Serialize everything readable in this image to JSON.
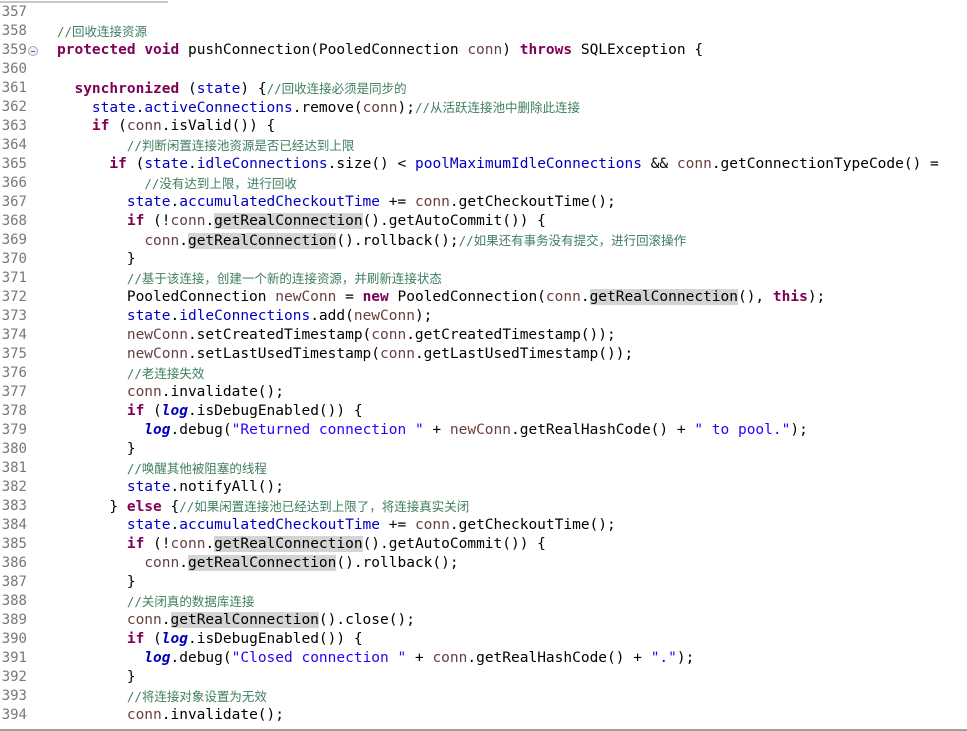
{
  "editor": {
    "colors": {
      "keyword": "#7f0055",
      "field": "#0000c0",
      "local": "#6a3e3e",
      "comment": "#3f7f5f",
      "string": "#2a00ff",
      "occurrence_highlight": "#d4d4d4"
    },
    "fold_icon_line": "359",
    "lines": [
      {
        "n": "357",
        "t": []
      },
      {
        "n": "358",
        "t": [
          [
            "c",
            "//回收连接资源"
          ]
        ]
      },
      {
        "n": "359",
        "t": [
          [
            "k",
            "protected"
          ],
          [
            "p",
            " "
          ],
          [
            "k",
            "void"
          ],
          [
            "p",
            " pushConnection(PooledConnection "
          ],
          [
            "v",
            "conn"
          ],
          [
            "p",
            ") "
          ],
          [
            "k",
            "throws"
          ],
          [
            "p",
            " SQLException {"
          ]
        ]
      },
      {
        "n": "360",
        "t": []
      },
      {
        "n": "361",
        "t": [
          [
            "p",
            "  "
          ],
          [
            "k",
            "synchronized"
          ],
          [
            "p",
            " ("
          ],
          [
            "f",
            "state"
          ],
          [
            "p",
            ") {"
          ],
          [
            "c",
            "//回收连接必须是同步的"
          ]
        ]
      },
      {
        "n": "362",
        "t": [
          [
            "p",
            "    "
          ],
          [
            "f",
            "state"
          ],
          [
            "p",
            "."
          ],
          [
            "f",
            "activeConnections"
          ],
          [
            "p",
            ".remove("
          ],
          [
            "v",
            "conn"
          ],
          [
            "p",
            ");"
          ],
          [
            "c",
            "//从活跃连接池中删除此连接"
          ]
        ]
      },
      {
        "n": "363",
        "t": [
          [
            "p",
            "    "
          ],
          [
            "k",
            "if"
          ],
          [
            "p",
            " ("
          ],
          [
            "v",
            "conn"
          ],
          [
            "p",
            ".isValid()) {"
          ]
        ]
      },
      {
        "n": "364",
        "t": [
          [
            "p",
            "        "
          ],
          [
            "c",
            "//判断闲置连接池资源是否已经达到上限"
          ]
        ]
      },
      {
        "n": "365",
        "t": [
          [
            "p",
            "      "
          ],
          [
            "k",
            "if"
          ],
          [
            "p",
            " ("
          ],
          [
            "f",
            "state"
          ],
          [
            "p",
            "."
          ],
          [
            "f",
            "idleConnections"
          ],
          [
            "p",
            ".size() < "
          ],
          [
            "f",
            "poolMaximumIdleConnections"
          ],
          [
            "p",
            " && "
          ],
          [
            "v",
            "conn"
          ],
          [
            "p",
            ".getConnectionTypeCode() ="
          ]
        ]
      },
      {
        "n": "366",
        "t": [
          [
            "p",
            "          "
          ],
          [
            "c",
            "//没有达到上限，进行回收"
          ]
        ]
      },
      {
        "n": "367",
        "t": [
          [
            "p",
            "        "
          ],
          [
            "f",
            "state"
          ],
          [
            "p",
            "."
          ],
          [
            "f",
            "accumulatedCheckoutTime"
          ],
          [
            "p",
            " += "
          ],
          [
            "v",
            "conn"
          ],
          [
            "p",
            ".getCheckoutTime();"
          ]
        ]
      },
      {
        "n": "368",
        "t": [
          [
            "p",
            "        "
          ],
          [
            "k",
            "if"
          ],
          [
            "p",
            " (!"
          ],
          [
            "v",
            "conn"
          ],
          [
            "p",
            "."
          ],
          [
            "h",
            "getRealConnection"
          ],
          [
            "p",
            "().getAutoCommit()) {"
          ]
        ]
      },
      {
        "n": "369",
        "t": [
          [
            "p",
            "          "
          ],
          [
            "v",
            "conn"
          ],
          [
            "p",
            "."
          ],
          [
            "h",
            "getRealConnection"
          ],
          [
            "p",
            "().rollback();"
          ],
          [
            "c",
            "//如果还有事务没有提交，进行回滚操作"
          ]
        ]
      },
      {
        "n": "370",
        "t": [
          [
            "p",
            "        }"
          ]
        ]
      },
      {
        "n": "371",
        "t": [
          [
            "p",
            "        "
          ],
          [
            "c",
            "//基于该连接，创建一个新的连接资源，并刷新连接状态"
          ]
        ]
      },
      {
        "n": "372",
        "t": [
          [
            "p",
            "        PooledConnection "
          ],
          [
            "v",
            "newConn"
          ],
          [
            "p",
            " = "
          ],
          [
            "k",
            "new"
          ],
          [
            "p",
            " PooledConnection("
          ],
          [
            "v",
            "conn"
          ],
          [
            "p",
            "."
          ],
          [
            "h",
            "getRealConnection"
          ],
          [
            "p",
            "(), "
          ],
          [
            "k",
            "this"
          ],
          [
            "p",
            ");"
          ]
        ]
      },
      {
        "n": "373",
        "t": [
          [
            "p",
            "        "
          ],
          [
            "f",
            "state"
          ],
          [
            "p",
            "."
          ],
          [
            "f",
            "idleConnections"
          ],
          [
            "p",
            ".add("
          ],
          [
            "v",
            "newConn"
          ],
          [
            "p",
            ");"
          ]
        ]
      },
      {
        "n": "374",
        "t": [
          [
            "p",
            "        "
          ],
          [
            "v",
            "newConn"
          ],
          [
            "p",
            ".setCreatedTimestamp("
          ],
          [
            "v",
            "conn"
          ],
          [
            "p",
            ".getCreatedTimestamp());"
          ]
        ]
      },
      {
        "n": "375",
        "t": [
          [
            "p",
            "        "
          ],
          [
            "v",
            "newConn"
          ],
          [
            "p",
            ".setLastUsedTimestamp("
          ],
          [
            "v",
            "conn"
          ],
          [
            "p",
            ".getLastUsedTimestamp());"
          ]
        ]
      },
      {
        "n": "376",
        "t": [
          [
            "p",
            "        "
          ],
          [
            "c",
            "//老连接失效"
          ]
        ]
      },
      {
        "n": "377",
        "t": [
          [
            "p",
            "        "
          ],
          [
            "v",
            "conn"
          ],
          [
            "p",
            ".invalidate();"
          ]
        ]
      },
      {
        "n": "378",
        "t": [
          [
            "p",
            "        "
          ],
          [
            "k",
            "if"
          ],
          [
            "p",
            " ("
          ],
          [
            "l",
            "log"
          ],
          [
            "p",
            ".isDebugEnabled()) {"
          ]
        ]
      },
      {
        "n": "379",
        "t": [
          [
            "p",
            "          "
          ],
          [
            "l",
            "log"
          ],
          [
            "p",
            ".debug("
          ],
          [
            "s",
            "\"Returned connection \""
          ],
          [
            "p",
            " + "
          ],
          [
            "v",
            "newConn"
          ],
          [
            "p",
            ".getRealHashCode() + "
          ],
          [
            "s",
            "\" to pool.\""
          ],
          [
            "p",
            ");"
          ]
        ]
      },
      {
        "n": "380",
        "t": [
          [
            "p",
            "        }"
          ]
        ]
      },
      {
        "n": "381",
        "t": [
          [
            "p",
            "        "
          ],
          [
            "c",
            "//唤醒其他被阻塞的线程"
          ]
        ]
      },
      {
        "n": "382",
        "t": [
          [
            "p",
            "        "
          ],
          [
            "f",
            "state"
          ],
          [
            "p",
            ".notifyAll();"
          ]
        ]
      },
      {
        "n": "383",
        "t": [
          [
            "p",
            "      } "
          ],
          [
            "k",
            "else"
          ],
          [
            "p",
            " {"
          ],
          [
            "c",
            "//如果闲置连接池已经达到上限了，将连接真实关闭"
          ]
        ]
      },
      {
        "n": "384",
        "t": [
          [
            "p",
            "        "
          ],
          [
            "f",
            "state"
          ],
          [
            "p",
            "."
          ],
          [
            "f",
            "accumulatedCheckoutTime"
          ],
          [
            "p",
            " += "
          ],
          [
            "v",
            "conn"
          ],
          [
            "p",
            ".getCheckoutTime();"
          ]
        ]
      },
      {
        "n": "385",
        "t": [
          [
            "p",
            "        "
          ],
          [
            "k",
            "if"
          ],
          [
            "p",
            " (!"
          ],
          [
            "v",
            "conn"
          ],
          [
            "p",
            "."
          ],
          [
            "h",
            "getRealConnection"
          ],
          [
            "p",
            "().getAutoCommit()) {"
          ]
        ]
      },
      {
        "n": "386",
        "t": [
          [
            "p",
            "          "
          ],
          [
            "v",
            "conn"
          ],
          [
            "p",
            "."
          ],
          [
            "h",
            "getRealConnection"
          ],
          [
            "p",
            "().rollback();"
          ]
        ]
      },
      {
        "n": "387",
        "t": [
          [
            "p",
            "        }"
          ]
        ]
      },
      {
        "n": "388",
        "t": [
          [
            "p",
            "        "
          ],
          [
            "c",
            "//关闭真的数据库连接"
          ]
        ]
      },
      {
        "n": "389",
        "t": [
          [
            "p",
            "        "
          ],
          [
            "v",
            "conn"
          ],
          [
            "p",
            "."
          ],
          [
            "h",
            "getRealConnection"
          ],
          [
            "p",
            "().close();"
          ]
        ]
      },
      {
        "n": "390",
        "t": [
          [
            "p",
            "        "
          ],
          [
            "k",
            "if"
          ],
          [
            "p",
            " ("
          ],
          [
            "l",
            "log"
          ],
          [
            "p",
            ".isDebugEnabled()) {"
          ]
        ]
      },
      {
        "n": "391",
        "t": [
          [
            "p",
            "          "
          ],
          [
            "l",
            "log"
          ],
          [
            "p",
            ".debug("
          ],
          [
            "s",
            "\"Closed connection \""
          ],
          [
            "p",
            " + "
          ],
          [
            "v",
            "conn"
          ],
          [
            "p",
            ".getRealHashCode() + "
          ],
          [
            "s",
            "\".\""
          ],
          [
            "p",
            ");"
          ]
        ]
      },
      {
        "n": "392",
        "t": [
          [
            "p",
            "        }"
          ]
        ]
      },
      {
        "n": "393",
        "t": [
          [
            "p",
            "        "
          ],
          [
            "c",
            "//将连接对象设置为无效"
          ]
        ]
      },
      {
        "n": "394",
        "t": [
          [
            "p",
            "        "
          ],
          [
            "v",
            "conn"
          ],
          [
            "p",
            ".invalidate();"
          ]
        ]
      }
    ]
  }
}
